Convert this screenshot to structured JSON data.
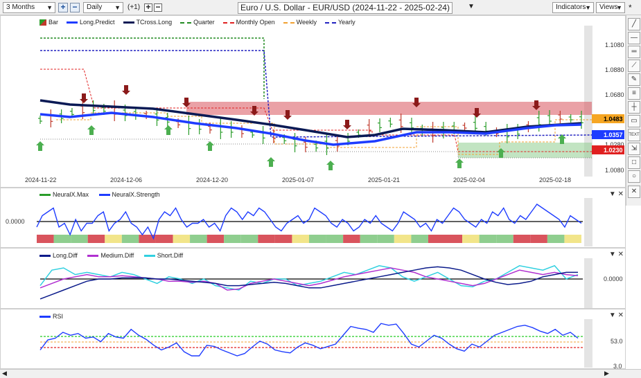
{
  "toolbar": {
    "period": "3 Months",
    "interval": "Daily",
    "offset": "(+1)",
    "title": "Euro / U.S. Dollar - EUR/USD (2024-11-22 - 2025-02-24)",
    "indicators": "Indicators",
    "views": "Views",
    "pin": "*"
  },
  "main_legend": [
    {
      "label": "Bar",
      "color": "#c0392b",
      "style": "bar"
    },
    {
      "label": "Long.Predict",
      "color": "#1e3cff",
      "style": "solid"
    },
    {
      "label": "TCross.Long",
      "color": "#0a1a55",
      "style": "solid"
    },
    {
      "label": "Quarter",
      "color": "#228b22",
      "style": "dash"
    },
    {
      "label": "Monthly Open",
      "color": "#e02020",
      "style": "dash"
    },
    {
      "label": "Weekly",
      "color": "#f0a030",
      "style": "dash"
    },
    {
      "label": "Yearly",
      "color": "#2020c0",
      "style": "dash"
    }
  ],
  "price_axis": [
    "1.1080",
    "1.0880",
    "1.0680",
    "1.0280",
    "1.0080"
  ],
  "price_tags": [
    {
      "value": "1.0483",
      "bg": "#f6a623",
      "color": "#000"
    },
    {
      "value": "1.0357",
      "bg": "#1e3cff",
      "color": "#fff"
    },
    {
      "value": "1.0230",
      "bg": "#e02020",
      "color": "#fff"
    }
  ],
  "date_axis": [
    "2024-11-22",
    "2024-12-06",
    "2024-12-20",
    "2025-01-07",
    "2025-01-21",
    "2025-02-04",
    "2025-02-18"
  ],
  "neural": {
    "legend": [
      "NeuralX.Max",
      "NeuralX.Strength"
    ],
    "axis": "0.0000",
    "strength": [
      0.4,
      0.7,
      0.8,
      0.9,
      0.4,
      0.5,
      0.2,
      0.6,
      0.3,
      0.5,
      0.5,
      0.7,
      0.8,
      0.3,
      0.5,
      0.6,
      0.8,
      0.5,
      0.4,
      0.2,
      0.4,
      0.1,
      0.6,
      0.8,
      0.7,
      0.9,
      0.6,
      0.4,
      0.5,
      0.5,
      0.6,
      0.4,
      0.5,
      0.3,
      0.7,
      0.9,
      0.8,
      0.6,
      0.8,
      0.7,
      0.9,
      0.8,
      0.6,
      0.4,
      0.3,
      0.5,
      0.6,
      0.7,
      0.5,
      0.6,
      0.9,
      0.8,
      0.7,
      0.5,
      0.4,
      0.6,
      0.5,
      0.3,
      0.4,
      0.6,
      0.5,
      0.7,
      0.5,
      0.4,
      0.3,
      0.5,
      0.8,
      0.7,
      0.6,
      0.4,
      0.5,
      0.3,
      0.6,
      0.5,
      0.7,
      0.9,
      0.8,
      0.6,
      0.5,
      0.4,
      0.6,
      0.5,
      0.8,
      0.7,
      0.9,
      0.6,
      0.5,
      0.7,
      0.6,
      0.8,
      1.0,
      0.9,
      0.8,
      0.7,
      0.6,
      0.4,
      0.7,
      0.6,
      0.5
    ]
  },
  "diff": {
    "legend": [
      {
        "label": "Long.Diff",
        "color": "#0a1a8a"
      },
      {
        "label": "Medium.Diff",
        "color": "#b030d0"
      },
      {
        "label": "Short.Diff",
        "color": "#30d0e0"
      }
    ],
    "axis": "0.0000",
    "long": [
      -0.9,
      -0.7,
      -0.5,
      -0.3,
      -0.1,
      0.0,
      0.0,
      0.05,
      0.05,
      0.05,
      0.0,
      0.0,
      -0.05,
      -0.1,
      -0.15,
      -0.2,
      -0.3,
      -0.3,
      -0.25,
      -0.2,
      -0.15,
      -0.2,
      -0.3,
      -0.4,
      -0.4,
      -0.3,
      -0.2,
      -0.1,
      0.0,
      0.1,
      0.2,
      0.3,
      0.4,
      0.5,
      0.55,
      0.5,
      0.4,
      0.2,
      0.0,
      -0.15,
      -0.25,
      -0.2,
      -0.1,
      0.1,
      0.2,
      0.3,
      0.3
    ],
    "medium": [
      -0.4,
      -0.2,
      0.0,
      0.1,
      0.2,
      0.1,
      0.1,
      0.15,
      0.1,
      0.05,
      0.0,
      -0.1,
      -0.1,
      -0.15,
      -0.1,
      -0.2,
      -0.5,
      -0.45,
      -0.2,
      -0.1,
      0.0,
      -0.1,
      -0.2,
      -0.3,
      -0.2,
      -0.05,
      0.1,
      0.2,
      0.3,
      0.4,
      0.5,
      0.4,
      0.3,
      0.1,
      0.0,
      -0.1,
      -0.2,
      -0.3,
      -0.2,
      0.0,
      0.2,
      0.4,
      0.3,
      0.2,
      0.3,
      0.2,
      0.15
    ],
    "short": [
      -0.3,
      0.4,
      0.5,
      0.2,
      0.3,
      0.2,
      0.1,
      0.3,
      0.2,
      0.0,
      -0.2,
      0.1,
      0.0,
      -0.2,
      0.0,
      -0.3,
      -0.4,
      -0.5,
      -0.1,
      -0.2,
      0.0,
      0.0,
      -0.3,
      -0.2,
      -0.1,
      0.1,
      0.3,
      0.2,
      0.4,
      0.6,
      0.5,
      0.1,
      -0.1,
      0.1,
      0.3,
      0.0,
      -0.3,
      -0.35,
      -0.1,
      0.0,
      0.3,
      0.6,
      0.5,
      0.4,
      0.6,
      0.0,
      0.2
    ]
  },
  "rsi": {
    "legend": "RSI",
    "axis": [
      "53.0",
      "3.0"
    ],
    "values": [
      30,
      47,
      50,
      60,
      55,
      58,
      50,
      52,
      44,
      58,
      52,
      50,
      65,
      55,
      48,
      38,
      30,
      35,
      42,
      27,
      20,
      20,
      38,
      36,
      30,
      25,
      20,
      24,
      35,
      45,
      40,
      30,
      27,
      25,
      35,
      42,
      38,
      32,
      36,
      40,
      55,
      70,
      67,
      65,
      60,
      75,
      72,
      74,
      58,
      40,
      35,
      45,
      55,
      50,
      40,
      32,
      28,
      40,
      35,
      45,
      55,
      60,
      65,
      70,
      72,
      68,
      62,
      58,
      65,
      55,
      60,
      50
    ]
  }
}
